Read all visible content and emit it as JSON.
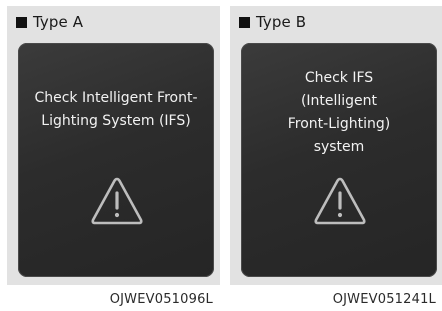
{
  "panels": [
    {
      "label": "Type A",
      "message_lines": [
        "Check Intelligent Front-",
        "Lighting System (IFS)"
      ],
      "icon": "warning-triangle-icon",
      "caption": "OJWEV051096L"
    },
    {
      "label": "Type B",
      "message_lines": [
        "Check IFS",
        "(Intelligent",
        "Front-Lighting)",
        "system"
      ],
      "icon": "warning-triangle-icon",
      "caption": "OJWEV051241L"
    }
  ],
  "colors": {
    "panel_background": "#e2e2e2",
    "screen_background": "#2c2c2c",
    "screen_text": "#f2f2f2",
    "icon_stroke": "#bdbdbd"
  }
}
